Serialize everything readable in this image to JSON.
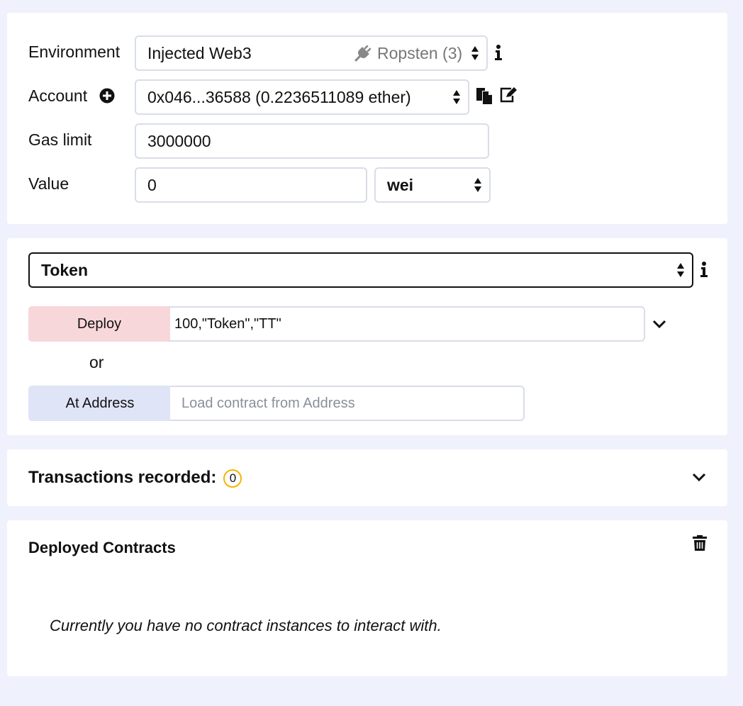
{
  "environment": {
    "label": "Environment",
    "value": "Injected Web3",
    "network": "Ropsten (3)",
    "network_icon": "plug-icon",
    "info_icon": "info-icon"
  },
  "account": {
    "label": "Account",
    "value": "0x046...36588 (0.2236511089 ether)",
    "add_icon": "plus-circle-icon",
    "copy_icon": "copy-icon",
    "edit_icon": "edit-icon"
  },
  "gas_limit": {
    "label": "Gas limit",
    "value": "3000000"
  },
  "value": {
    "label": "Value",
    "amount": "0",
    "unit": "wei"
  },
  "contract": {
    "selected": "Token"
  },
  "deploy": {
    "button_label": "Deploy",
    "args": "100,\"Token\",\"TT\"",
    "or_text": "or",
    "at_address_label": "At Address",
    "at_address_placeholder": "Load contract from Address"
  },
  "transactions": {
    "title": "Transactions recorded:",
    "count": "0"
  },
  "deployed": {
    "title": "Deployed Contracts",
    "empty_message": "Currently you have no contract instances to interact with."
  },
  "colors": {
    "background": "#eff2fd",
    "deploy_button": "#f8d7da",
    "at_address_button": "#dfe4f7",
    "badge_border": "#f5b400"
  }
}
